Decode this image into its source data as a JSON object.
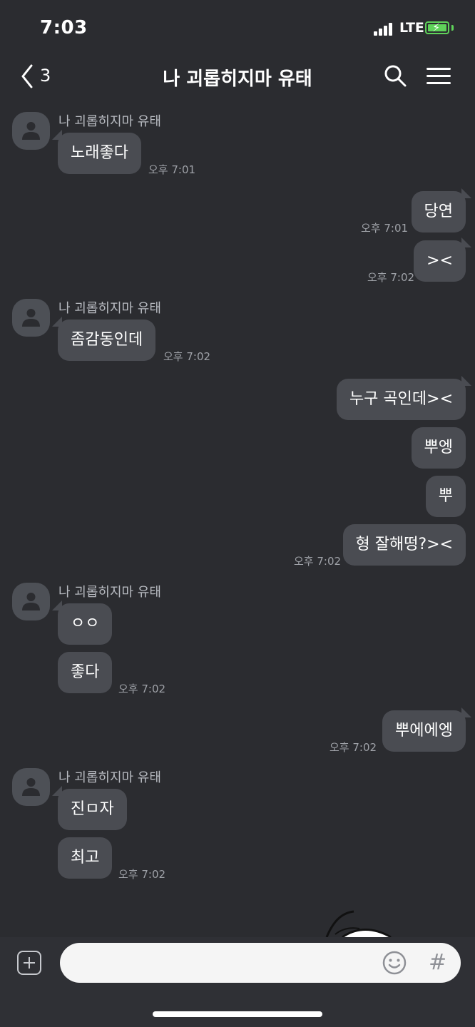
{
  "status_bar": {
    "time": "7:03",
    "network": "LTE"
  },
  "header": {
    "unread_count": "3",
    "title": "나 괴롭히지마 유태"
  },
  "messages": [
    {
      "sender": "나 괴롭히지마 유태",
      "text": "노래좋다",
      "time": "오후 7:01"
    },
    {
      "text": "당연",
      "time": "오후 7:01"
    },
    {
      "text": "><",
      "time": "오후 7:02"
    },
    {
      "sender": "나 괴롭히지마 유태",
      "text": "좀감동인데",
      "time": "오후 7:02"
    },
    {
      "text": "누구 곡인데><"
    },
    {
      "text": "뿌엥"
    },
    {
      "text": "뿌"
    },
    {
      "text": "형 잘해떵?><",
      "time": "오후 7:02"
    },
    {
      "sender": "나 괴롭히지마 유태",
      "text": "ㅇㅇ"
    },
    {
      "text": "좋다",
      "time": "오후 7:02"
    },
    {
      "text": "뿌에에엥",
      "time": "오후 7:02"
    },
    {
      "sender": "나 괴롭히지마 유태",
      "text": "진ㅁ자"
    },
    {
      "text": "최고",
      "time": "오후 7:02"
    }
  ],
  "input": {
    "placeholder": "",
    "value": ""
  },
  "icons": [
    "back-icon",
    "search-icon",
    "menu-icon",
    "profile-icon",
    "plus-icon",
    "emoji-icon",
    "hash-icon"
  ],
  "colors": {
    "background": "#2b2c30",
    "bubble": "#4a4c52",
    "battery": "#5fd35a"
  }
}
